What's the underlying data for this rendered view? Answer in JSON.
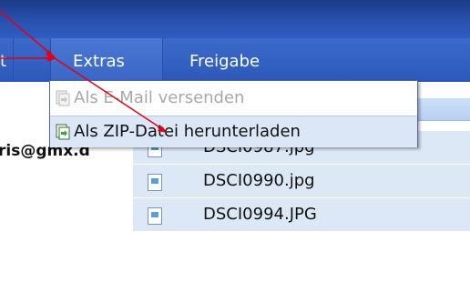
{
  "menubar": {
    "items": [
      {
        "label": "t"
      },
      {
        "label": "Extras"
      },
      {
        "label": "Freigabe"
      }
    ]
  },
  "dropdown": {
    "items": [
      {
        "label": "Als E-Mail versenden",
        "enabled": false,
        "icon": "email-send-icon"
      },
      {
        "label": "Als ZIP-Datei herunterladen",
        "enabled": true,
        "icon": "zip-download-icon"
      }
    ]
  },
  "sidebar": {
    "email_partial": "ris@gmx.d"
  },
  "files": [
    {
      "name": "DSCI0987.jpg",
      "icon": "image-file-icon"
    },
    {
      "name": "DSCI0990.jpg",
      "icon": "image-file-icon"
    },
    {
      "name": "DSCI0994.JPG",
      "icon": "image-file-icon"
    }
  ],
  "colors": {
    "menubar": "#3462c4",
    "selection": "#dbe6f7",
    "annotation_arrow": "#e0001a"
  }
}
